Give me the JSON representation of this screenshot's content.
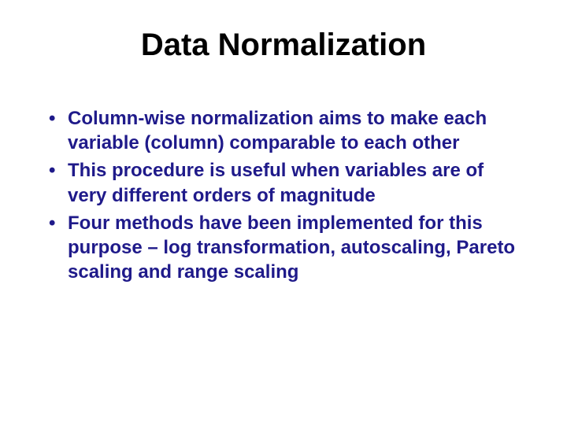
{
  "slide": {
    "title": "Data Normalization",
    "bullets": [
      "Column-wise normalization aims to make each variable (column) comparable to each other",
      "This procedure is useful when variables are of very different orders of magnitude",
      "Four methods have been implemented for this purpose – log transformation, autoscaling, Pareto scaling and range scaling"
    ]
  }
}
